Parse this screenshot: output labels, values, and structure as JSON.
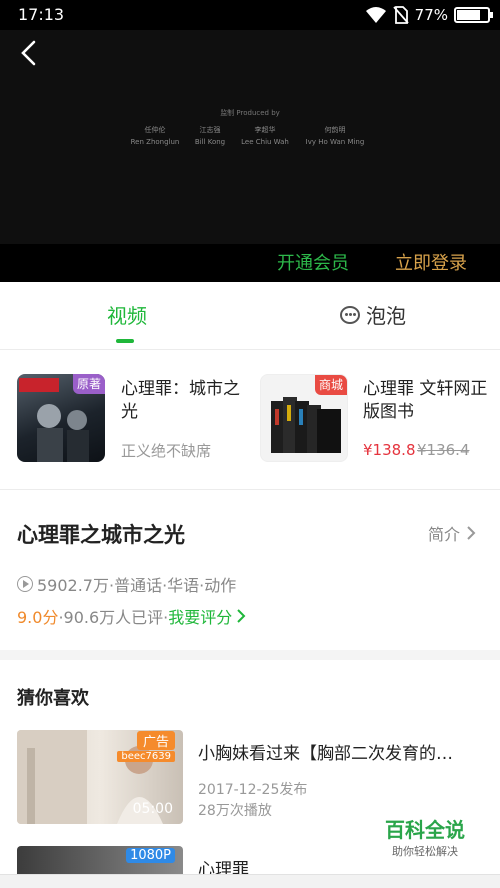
{
  "status_bar": {
    "time": "17:13",
    "battery": "77%",
    "battery_level": 0.77
  },
  "player": {
    "credits_title": "监制 Produced by",
    "credits": [
      {
        "cn": "任仲伦",
        "en": "Ren Zhonglun"
      },
      {
        "cn": "江志强",
        "en": "Bill Kong"
      },
      {
        "cn": "李超华",
        "en": "Lee Chiu Wah"
      },
      {
        "cn": "何韵明",
        "en": "Ivy Ho Wan Ming"
      }
    ],
    "vip_label": "开通会员",
    "login_label": "立即登录"
  },
  "tabs": [
    {
      "label": "视频",
      "active": true
    },
    {
      "label": "泡泡",
      "active": false
    }
  ],
  "cards": [
    {
      "badge": "原著",
      "title": "心理罪：城市之光",
      "subtitle": "正义绝不缺席"
    },
    {
      "badge": "商城",
      "title": "心理罪 文轩网正版图书",
      "price": "¥138.8",
      "old_price": "¥136.4"
    }
  ],
  "detail": {
    "title": "心理罪之城市之光",
    "intro_label": "简介",
    "meta": "5902.7万·普通话·华语·动作",
    "score": "9.0分",
    "rating_text": "·90.6万人已评·",
    "rate_label": "我要评分"
  },
  "recommend": {
    "section_title": "猜你喜欢",
    "items": [
      {
        "title": "小胸妹看过来【胸部二次发育的…",
        "ad_tag": "广告",
        "ad_code": "beec7639",
        "duration": "05:00",
        "date": "2017-12-25发布",
        "plays": "28万次播放"
      },
      {
        "title": "心理罪",
        "hd_tag": "1080P"
      }
    ]
  },
  "watermark": {
    "main": "百科全说",
    "sub": "助你轻松解决"
  },
  "colors": {
    "accent_green": "#1fb73a",
    "login_gold": "#d7a24b",
    "price_red": "#e5343e",
    "score_orange": "#f08a2c"
  }
}
